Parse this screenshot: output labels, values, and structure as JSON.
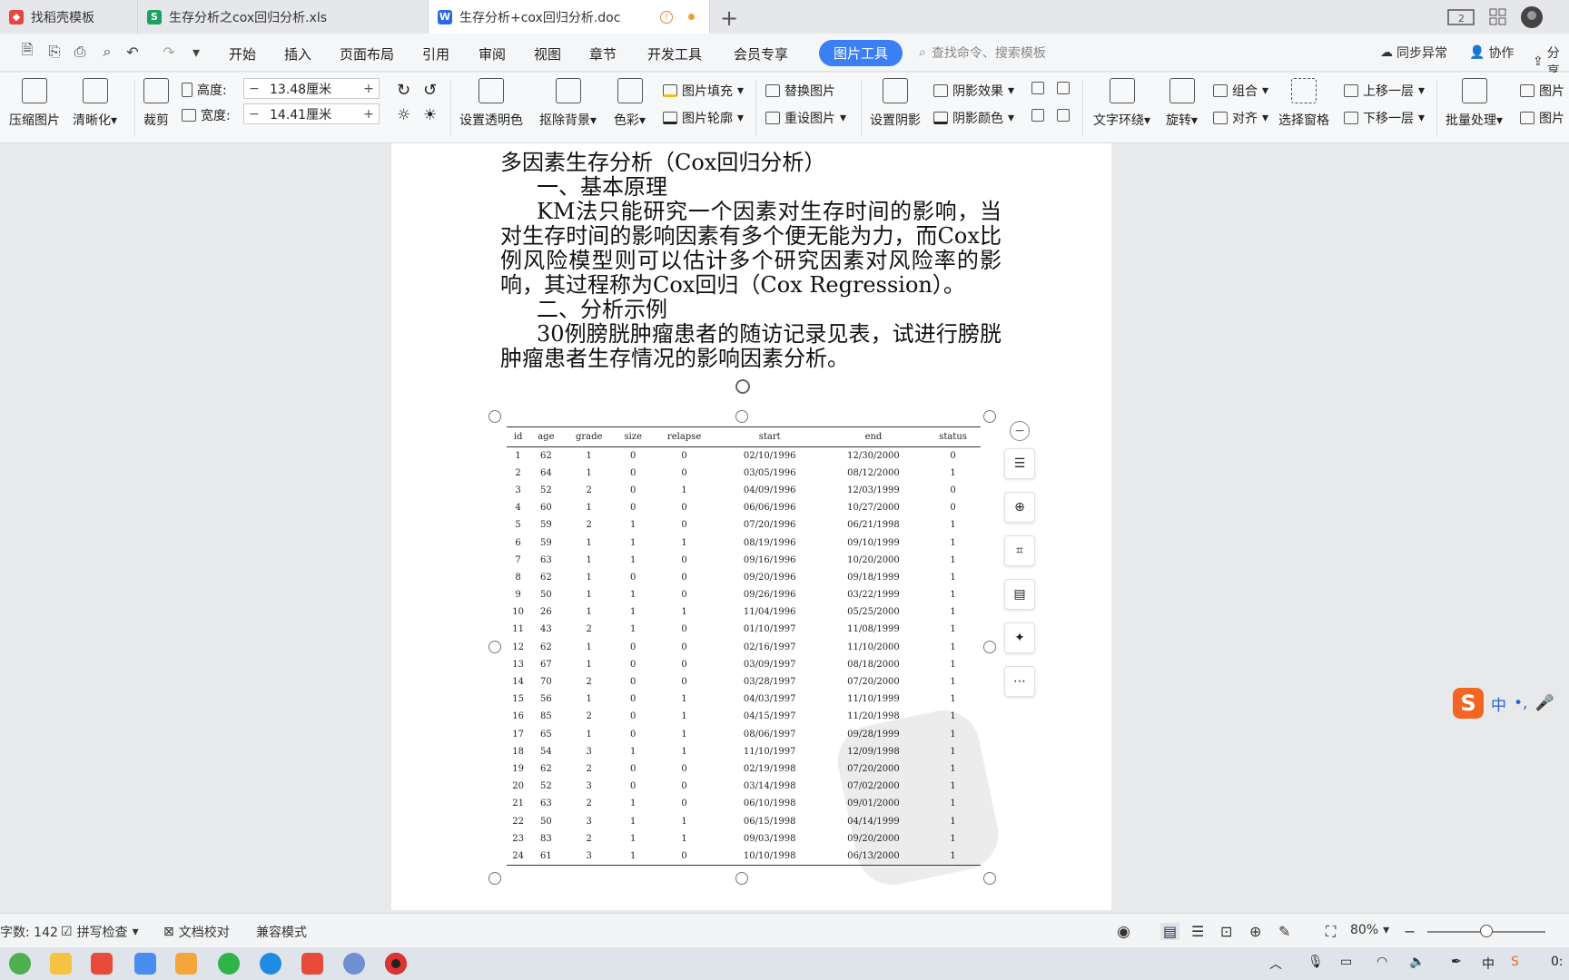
{
  "tabs": [
    {
      "label": "找稻壳模板",
      "icon": "daoke-icon",
      "color": "#e8453c"
    },
    {
      "label": "生存分析之cox回归分析.xls",
      "icon": "spreadsheet-icon",
      "color": "#1aa260"
    },
    {
      "label": "生存分析+cox回归分析.doc",
      "icon": "word-doc-icon",
      "color": "#2b6ae6"
    }
  ],
  "menu": {
    "items": [
      "开始",
      "插入",
      "页面布局",
      "引用",
      "审阅",
      "视图",
      "章节",
      "开发工具",
      "会员专享"
    ],
    "active_tool": "图片工具",
    "search_placeholder": "查找命令、搜索模板",
    "sync": "同步异常",
    "collab": "协作",
    "share": "分享"
  },
  "ribbon": {
    "compress": "压缩图片",
    "clarify": "清晰化",
    "crop": "裁剪",
    "height_label": "高度:",
    "height_value": "13.48厘米",
    "width_label": "宽度:",
    "width_value": "14.41厘米",
    "transparent": "设置透明色",
    "remove_bg": "抠除背景",
    "color": "色彩",
    "fill": "图片填充",
    "outline": "图片轮廓",
    "replace": "替换图片",
    "reset": "重设图片",
    "shadow_set": "设置阴影",
    "shadow_effect": "阴影效果",
    "shadow_color": "阴影颜色",
    "wrap": "文字环绕",
    "rotate": "旋转",
    "group": "组合",
    "align": "对齐",
    "select_pane": "选择窗格",
    "bring_forward": "上移一层",
    "send_backward": "下移一层",
    "batch": "批量处理",
    "picture": "图片"
  },
  "document": {
    "title": "多因素生存分析（Cox回归分析）",
    "h1": "一、基本原理",
    "p1": "KM法只能研究一个因素对生存时间的影响，当对生存时间的影响因素有多个便无能为力，而Cox比例风险模型则可以估计多个研究因素对风险率的影响，其过程称为Cox回归（Cox Regression）。",
    "h2": "二、分析示例",
    "p2": "30例膀胱肿瘤患者的随访记录见表，试进行膀胱肿瘤患者生存情况的影响因素分析。"
  },
  "table": {
    "headers": [
      "id",
      "age",
      "grade",
      "size",
      "relapse",
      "start",
      "end",
      "status"
    ],
    "rows": [
      [
        "1",
        "62",
        "1",
        "0",
        "0",
        "02/10/1996",
        "12/30/2000",
        "0"
      ],
      [
        "2",
        "64",
        "1",
        "0",
        "0",
        "03/05/1996",
        "08/12/2000",
        "1"
      ],
      [
        "3",
        "52",
        "2",
        "0",
        "1",
        "04/09/1996",
        "12/03/1999",
        "0"
      ],
      [
        "4",
        "60",
        "1",
        "0",
        "0",
        "06/06/1996",
        "10/27/2000",
        "0"
      ],
      [
        "5",
        "59",
        "2",
        "1",
        "0",
        "07/20/1996",
        "06/21/1998",
        "1"
      ],
      [
        "6",
        "59",
        "1",
        "1",
        "1",
        "08/19/1996",
        "09/10/1999",
        "1"
      ],
      [
        "7",
        "63",
        "1",
        "1",
        "0",
        "09/16/1996",
        "10/20/2000",
        "1"
      ],
      [
        "8",
        "62",
        "1",
        "0",
        "0",
        "09/20/1996",
        "09/18/1999",
        "1"
      ],
      [
        "9",
        "50",
        "1",
        "1",
        "0",
        "09/26/1996",
        "03/22/1999",
        "1"
      ],
      [
        "10",
        "26",
        "1",
        "1",
        "1",
        "11/04/1996",
        "05/25/2000",
        "1"
      ],
      [
        "11",
        "43",
        "2",
        "1",
        "0",
        "01/10/1997",
        "11/08/1999",
        "1"
      ],
      [
        "12",
        "62",
        "1",
        "0",
        "0",
        "02/16/1997",
        "11/10/2000",
        "1"
      ],
      [
        "13",
        "67",
        "1",
        "0",
        "0",
        "03/09/1997",
        "08/18/2000",
        "1"
      ],
      [
        "14",
        "70",
        "2",
        "0",
        "0",
        "03/28/1997",
        "07/20/2000",
        "1"
      ],
      [
        "15",
        "56",
        "1",
        "0",
        "1",
        "04/03/1997",
        "11/10/1999",
        "1"
      ],
      [
        "16",
        "85",
        "2",
        "0",
        "1",
        "04/15/1997",
        "11/20/1998",
        "1"
      ],
      [
        "17",
        "65",
        "1",
        "0",
        "1",
        "08/06/1997",
        "09/28/1999",
        "1"
      ],
      [
        "18",
        "54",
        "3",
        "1",
        "1",
        "11/10/1997",
        "12/09/1998",
        "1"
      ],
      [
        "19",
        "62",
        "2",
        "0",
        "0",
        "02/19/1998",
        "07/20/2000",
        "1"
      ],
      [
        "20",
        "52",
        "3",
        "0",
        "0",
        "03/14/1998",
        "07/02/2000",
        "1"
      ],
      [
        "21",
        "63",
        "2",
        "1",
        "0",
        "06/10/1998",
        "09/01/2000",
        "1"
      ],
      [
        "22",
        "50",
        "3",
        "1",
        "1",
        "06/15/1998",
        "04/14/1999",
        "1"
      ],
      [
        "23",
        "83",
        "2",
        "1",
        "1",
        "09/03/1998",
        "09/20/2000",
        "1"
      ],
      [
        "24",
        "61",
        "3",
        "1",
        "0",
        "10/10/1998",
        "06/13/2000",
        "1"
      ]
    ]
  },
  "status": {
    "word_count": "字数: 142",
    "spell": "拼写检查",
    "proof": "文档校对",
    "compat": "兼容模式",
    "zoom": "80%"
  },
  "ime": {
    "label": "中"
  },
  "taskbar": {
    "clock": "0:"
  }
}
